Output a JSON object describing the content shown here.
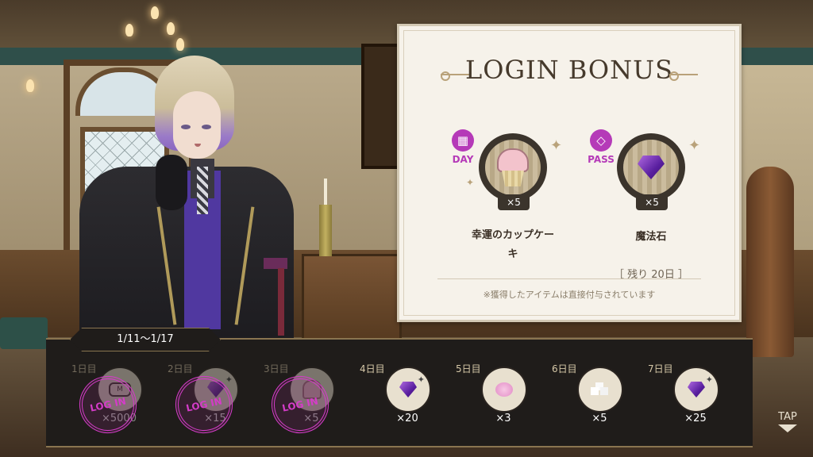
{
  "card": {
    "title": "LOGIN BONUS",
    "day_reward": {
      "badge_label": "DAY",
      "badge_icon": "calendar-icon",
      "item_icon": "cupcake-icon",
      "quantity": "×5",
      "name_line1": "幸運のカップケー",
      "name_line2": "キ"
    },
    "pass_reward": {
      "badge_label": "PASS",
      "badge_icon": "diamond-icon",
      "item_icon": "magic-stone-icon",
      "quantity": "×5",
      "name": "魔法石",
      "remaining": "［ 残り 20日 ］"
    },
    "note": "※獲得したアイテムは直接付与されています"
  },
  "week": {
    "date_range": "1/11～1/17",
    "days": [
      {
        "label": "1日目",
        "icon": "mana-icon",
        "icon_text": "M",
        "quantity": "×5000",
        "claimed": true
      },
      {
        "label": "2日目",
        "icon": "magic-stone-icon",
        "quantity": "×15",
        "claimed": true
      },
      {
        "label": "3日目",
        "icon": "cupcake-icon",
        "quantity": "×5",
        "claimed": true
      },
      {
        "label": "4日目",
        "icon": "magic-stone-icon",
        "quantity": "×20",
        "claimed": false
      },
      {
        "label": "5日目",
        "icon": "pink-flower-icon",
        "quantity": "×3",
        "claimed": false
      },
      {
        "label": "6日目",
        "icon": "sugar-cubes-icon",
        "quantity": "×5",
        "claimed": false
      },
      {
        "label": "7日目",
        "icon": "magic-stone-icon",
        "quantity": "×25",
        "claimed": false
      }
    ],
    "stamp_text": "LOG IN"
  },
  "tap_label": "TAP",
  "colors": {
    "accent_magenta": "#b53ab8",
    "stamp_magenta": "#d43cc8",
    "card_bg": "#f6f2ea",
    "bar_bg": "#1f1c1a",
    "gold_trim": "#8a7550"
  }
}
